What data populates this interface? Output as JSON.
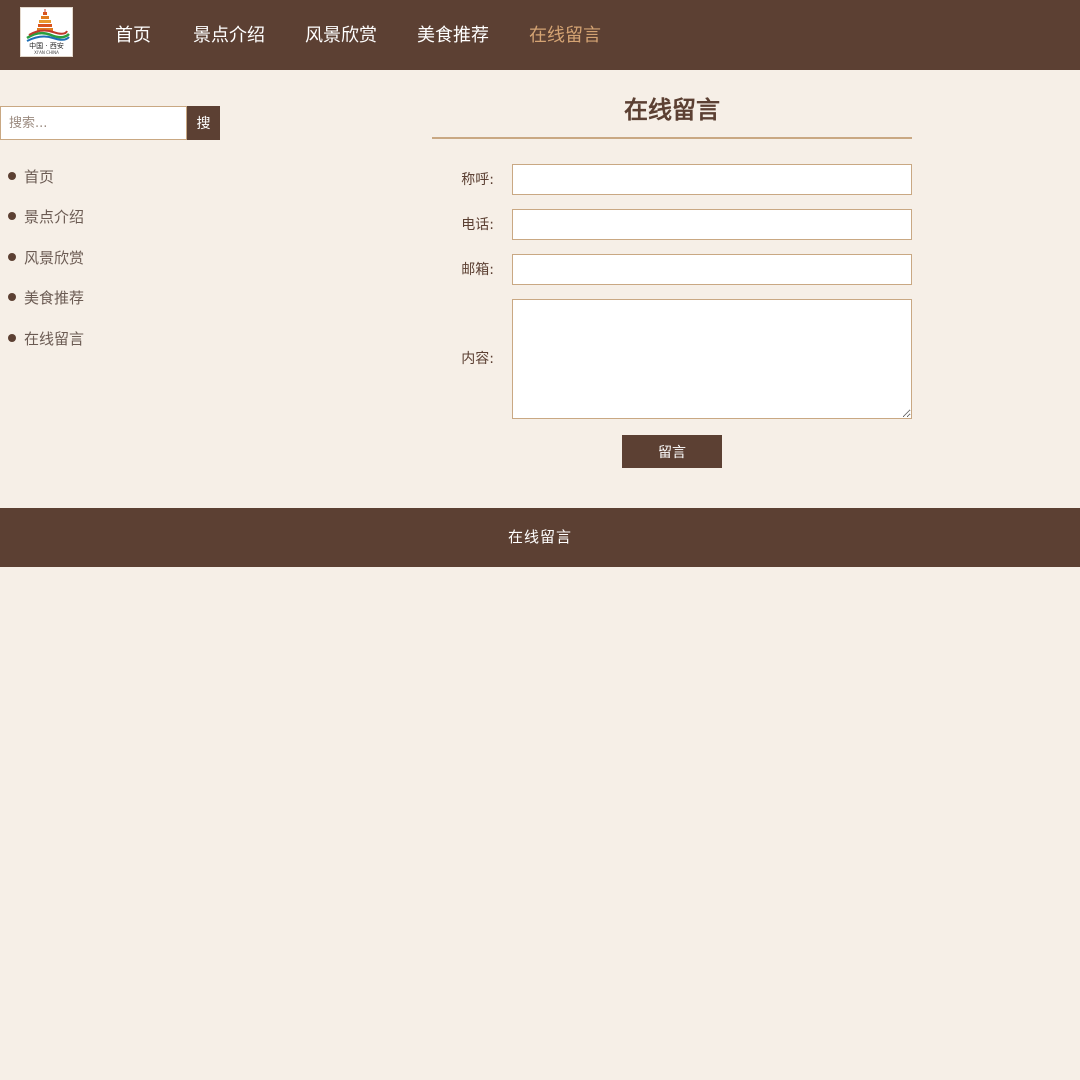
{
  "colors": {
    "primary": "#5c4033",
    "accent": "#d4a373",
    "background": "#f6efe7",
    "border": "#c9a883",
    "text": "#5c4033",
    "sidebar_text": "#6b5b53"
  },
  "header": {
    "logo": {
      "icon": "xian-pagoda-logo",
      "text": "中国 · 西安",
      "subtext": "XI'AN CHINA"
    },
    "nav": [
      {
        "label": "首页",
        "active": false
      },
      {
        "label": "景点介绍",
        "active": false
      },
      {
        "label": "风景欣赏",
        "active": false
      },
      {
        "label": "美食推荐",
        "active": false
      },
      {
        "label": "在线留言",
        "active": true
      }
    ]
  },
  "sidebar": {
    "search": {
      "placeholder": "搜索...",
      "value": "",
      "button_label": "搜"
    },
    "items": [
      {
        "label": "首页"
      },
      {
        "label": "景点介绍"
      },
      {
        "label": "风景欣赏"
      },
      {
        "label": "美食推荐"
      },
      {
        "label": "在线留言"
      }
    ]
  },
  "main": {
    "title": "在线留言",
    "form": {
      "name": {
        "label": "称呼:",
        "value": ""
      },
      "phone": {
        "label": "电话:",
        "value": ""
      },
      "email": {
        "label": "邮箱:",
        "value": ""
      },
      "content": {
        "label": "内容:",
        "value": ""
      },
      "submit_label": "留言"
    }
  },
  "footer": {
    "text": "在线留言"
  }
}
